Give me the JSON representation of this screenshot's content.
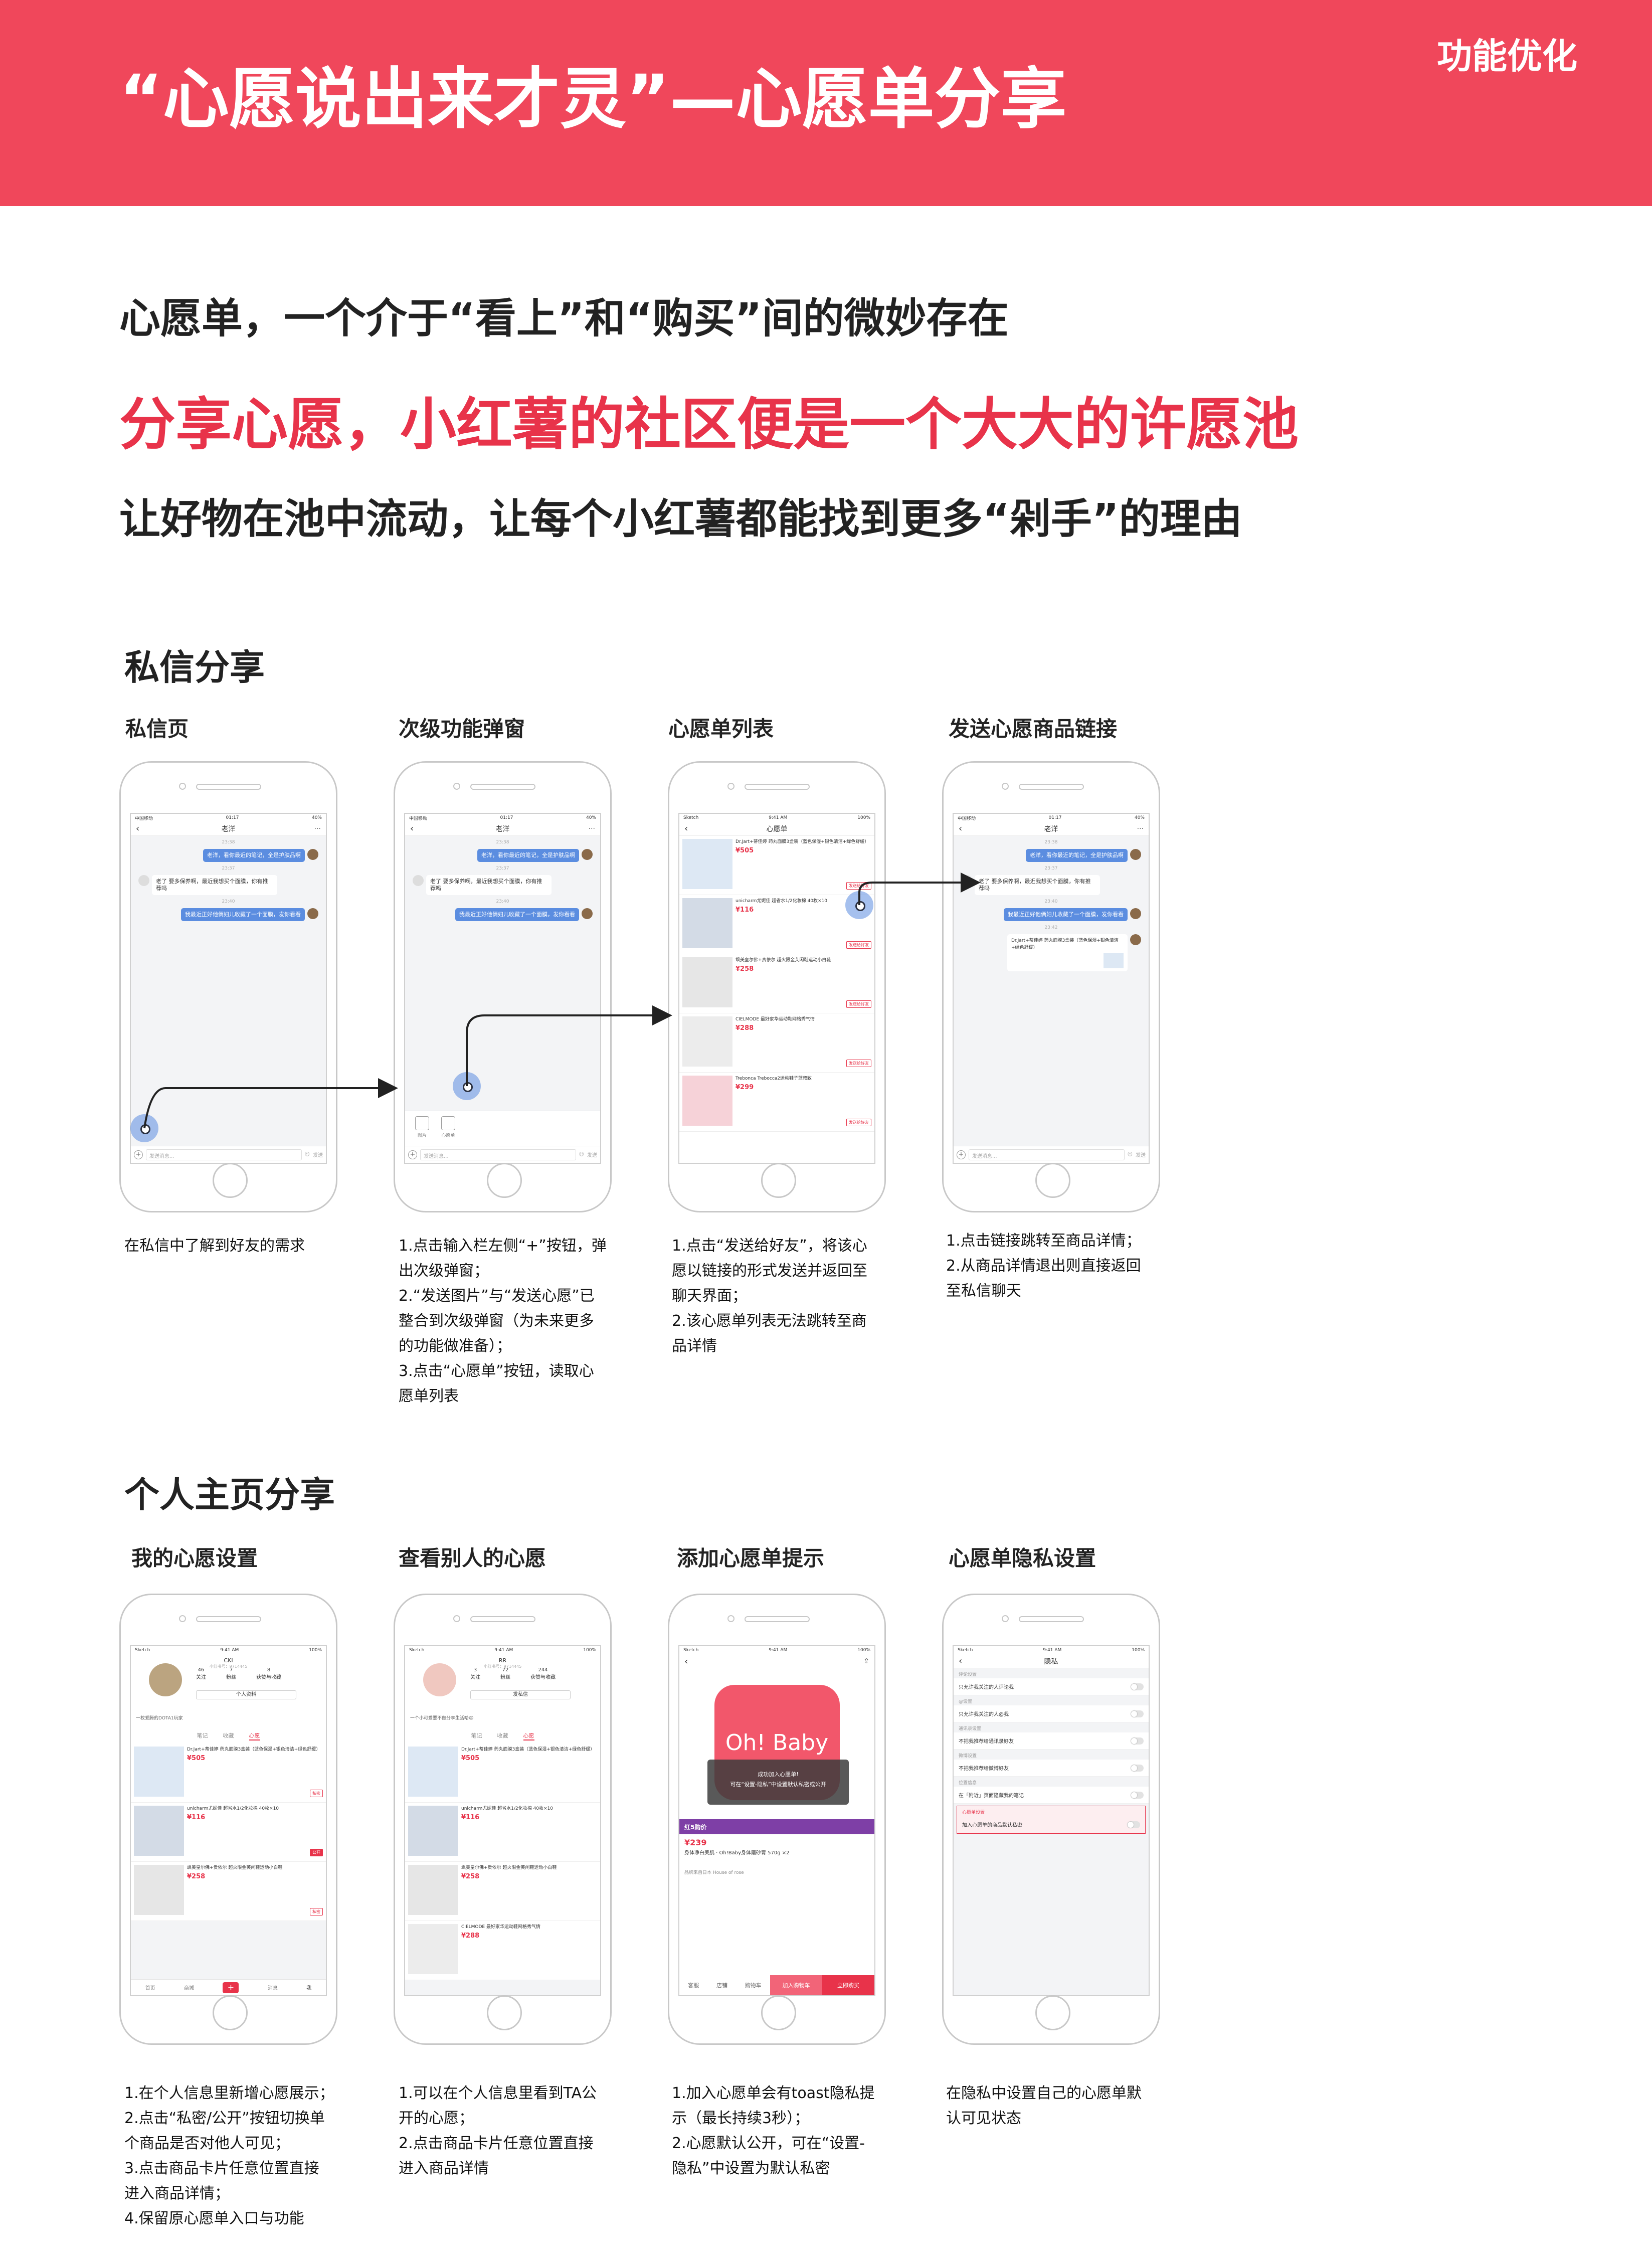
{
  "header": {
    "title": "“心愿说出来才灵”—心愿单分享",
    "tag": "功能优化",
    "bg_color": "#f0475b"
  },
  "intro": {
    "line1": "心愿单，一个介于“看上”和“购买”间的微妙存在",
    "line2": "分享心愿，小红薯的社区便是一个大大的许愿池",
    "line3": "让好物在池中流动，让每个小红薯都能找到更多“剁手”的理由",
    "accent_color": "#e8334a"
  },
  "section1": {
    "title": "私信分享",
    "cols": [
      {
        "title": "私信页",
        "desc": [
          "在私信中了解到好友的需求"
        ]
      },
      {
        "title": "次级功能弹窗",
        "desc": [
          "1.点击输入栏左侧“+”按钮，弹",
          "出次级弹窗；",
          "2.“发送图片”与“发送心愿”已",
          "整合到次级弹窗（为未来更多",
          "的功能做准备）；",
          "3.点击“心愿单”按钮，读取心",
          "愿单列表"
        ]
      },
      {
        "title": "心愿单列表",
        "desc": [
          "1.点击“发送给好友”，将该心",
          "愿以链接的形式发送并返回至",
          "聊天界面；",
          "2.该心愿单列表无法跳转至商",
          "品详情"
        ]
      },
      {
        "title": "发送心愿商品链接",
        "desc": [
          "1.点击链接跳转至商品详情；",
          "2.从商品详情退出则直接返回",
          "至私信聊天"
        ]
      }
    ]
  },
  "section2": {
    "title": "个人主页分享",
    "cols": [
      {
        "title": "我的心愿设置",
        "desc": [
          "1.在个人信息里新增心愿展示；",
          "2.点击“私密/公开”按钮切换单",
          "个商品是否对他人可见；",
          "3.点击商品卡片任意位置直接",
          "进入商品详情；",
          "4.保留原心愿单入口与功能"
        ]
      },
      {
        "title": "查看别人的心愿",
        "desc": [
          "1.可以在个人信息里看到TA公",
          "开的心愿；",
          "2.点击商品卡片任意位置直接",
          "进入商品详情"
        ]
      },
      {
        "title": "添加心愿单提示",
        "desc": [
          "1.加入心愿单会有toast隐私提",
          "示（最长持续3秒）；",
          "2.心愿默认公开，可在“设置-",
          "隐私”中设置为默认私密"
        ]
      },
      {
        "title": "心愿单隐私设置",
        "desc": [
          "在隐私中设置自己的心愿单默",
          "认可见状态"
        ]
      }
    ]
  },
  "chat": {
    "carrier": "中国移动",
    "time": "01:17",
    "battery": "40%",
    "name": "老洋",
    "ts1": "23:38",
    "ts2": "23:37",
    "ts3": "23:40",
    "ts4": "23:42",
    "m1": "老洋，看你最近的笔记，全是护肤品啊",
    "m2": "老了 要多保养啊，最近我想买个面膜，你有推荐吗",
    "m3": "我最近正好他俩妇儿收藏了一个面膜，发你看看",
    "m4": "那款我都用过 还不错 可以试试看",
    "input": "发送消息...",
    "send": "发送",
    "pop_photo": "图片",
    "pop_wish": "心愿单"
  },
  "wishlist": {
    "carrier": "Sketch",
    "time": "9:41 AM",
    "battery": "100%",
    "title": "心愿单",
    "send_label": "发送给好友",
    "items": [
      {
        "name": "Dr.Jart+蒂佳婷 药丸面膜3盒装（蓝色保湿+银色清洁+绿色舒缓）",
        "price": "¥505"
      },
      {
        "name": "unicharm尤妮佳 超省水1/2化妆棉 40枚×10",
        "price": "¥116"
      },
      {
        "name": "飒美皇尔佛+贵依尔 超火限金芙闲鞋运动小白鞋",
        "price": "¥258"
      },
      {
        "name": "CIELMODE 最好家华运动鞋网格秀气情",
        "price": "¥288"
      },
      {
        "name": "Trebonca Trebocca2运动鞋子蓝叙致",
        "price": "¥299"
      }
    ]
  },
  "profile_me": {
    "name": "CKI",
    "id": "小红书号：9714445",
    "stats": [
      {
        "n": "46",
        "l": "关注"
      },
      {
        "n": "7",
        "l": "粉丝"
      },
      {
        "n": "8",
        "l": "获赞与收藏"
      }
    ],
    "edit": "个人资料",
    "bio": "一枚爱腾的DOTA1玩家",
    "tabs": [
      "笔记",
      "收藏",
      "心愿"
    ],
    "private": "私密",
    "public": "公开",
    "tabbar": [
      "首页",
      "商城",
      "+",
      "消息",
      "我"
    ]
  },
  "profile_other": {
    "name": "RR",
    "id": "小红书号：9714445",
    "stats": [
      {
        "n": "3",
        "l": "关注"
      },
      {
        "n": "72",
        "l": "粉丝"
      },
      {
        "n": "244",
        "l": "获赞与收藏"
      }
    ],
    "follow": "发私信",
    "bio": "一个小可爱要不做分享生活哈😊",
    "tabs": [
      "笔记",
      "收藏",
      "心愿"
    ]
  },
  "product": {
    "jar": "Oh! Baby",
    "toast1": "成功加入心愿单!",
    "toast2": "可在“设置-隐私”中设置默认私密或公开",
    "promo": "红5购价",
    "price": "¥239",
    "name": "身体净白美肌 · Oh!Baby身体磨砂膏 570g ×2",
    "origin": "品牌来自日本 House of rose",
    "cart": "加入购物车",
    "buy": "立即购买",
    "icons": [
      "客服",
      "店铺",
      "购物车"
    ]
  },
  "privacy": {
    "title": "隐私",
    "rows": [
      {
        "group": "评论设置",
        "label": "只允许我关注的人评论我"
      },
      {
        "group": "@设置",
        "label": "只允许我关注的人@我"
      },
      {
        "group": "通讯录设置",
        "label": "不把我推荐给通讯录好友"
      },
      {
        "group": "微博设置",
        "label": "不把我推荐给微博好友"
      },
      {
        "group": "位置信息",
        "label": "在「附近」页面隐藏我的笔记"
      },
      {
        "group": "心愿单设置",
        "label": "加入心愿单的商品默认私密"
      }
    ]
  }
}
